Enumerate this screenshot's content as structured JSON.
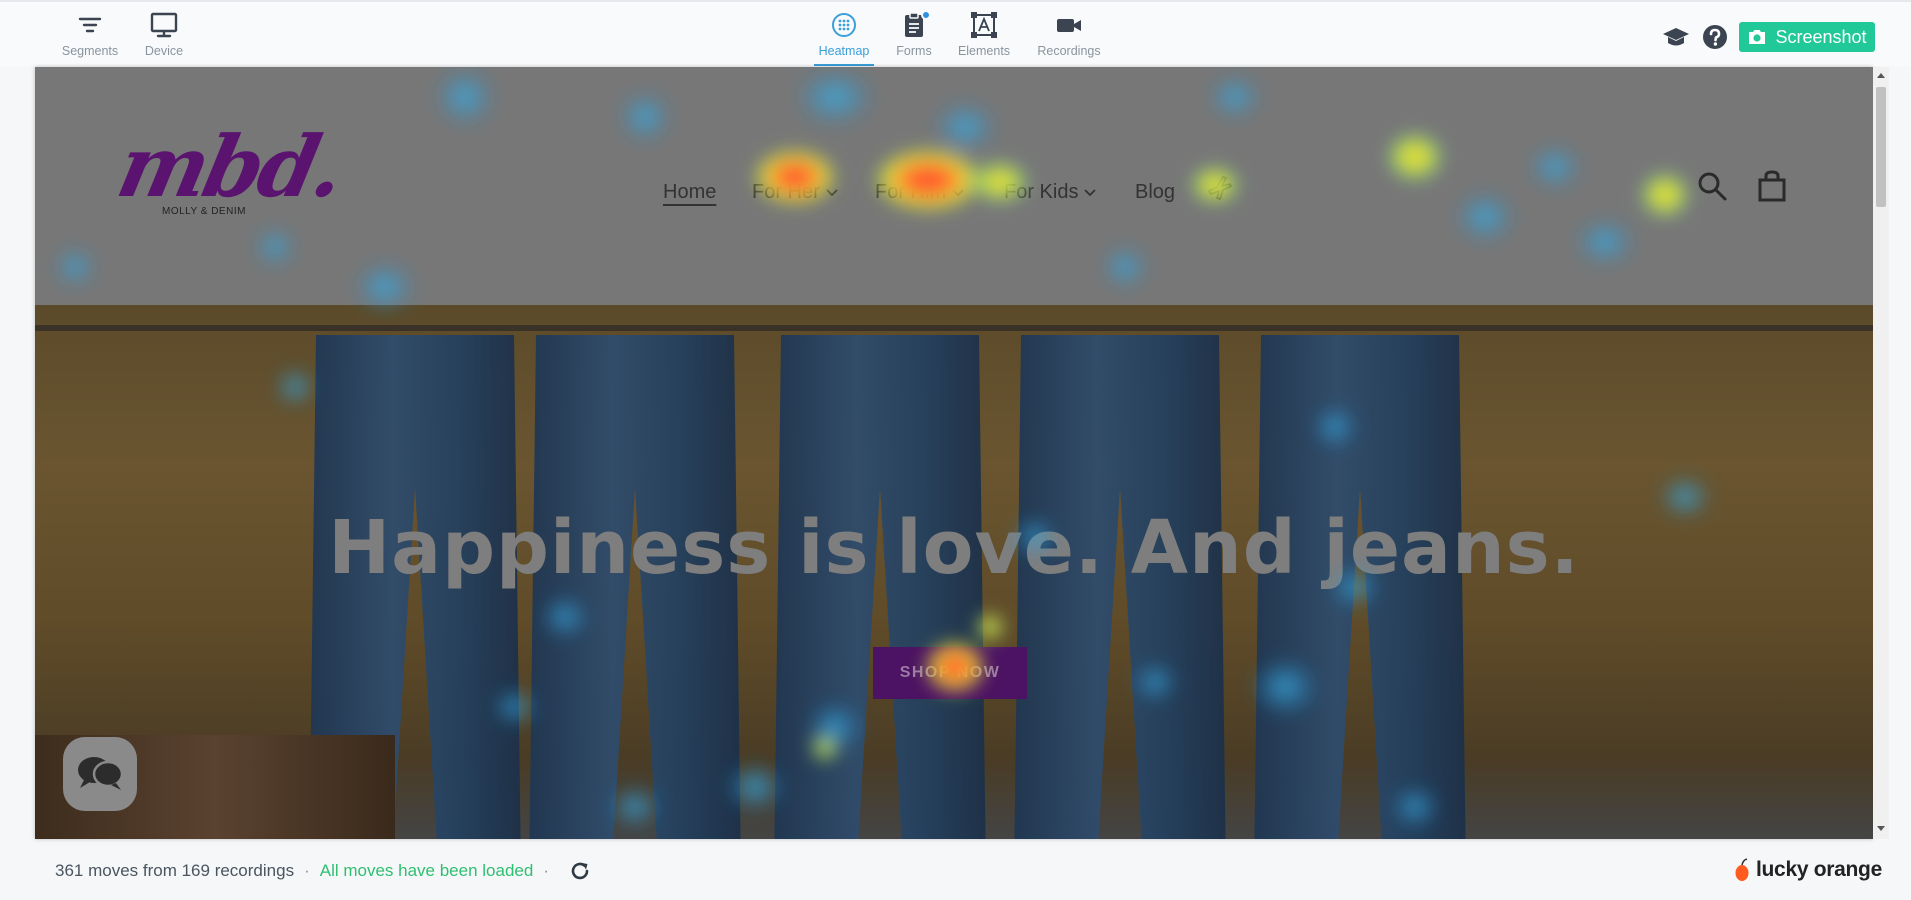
{
  "toolbar": {
    "left_tools": [
      {
        "label": "Segments",
        "icon": "filter-icon"
      },
      {
        "label": "Device",
        "icon": "monitor-icon"
      }
    ],
    "center_tools": [
      {
        "label": "Heatmap",
        "icon": "heatmap-icon",
        "active": true
      },
      {
        "label": "Forms",
        "icon": "clipboard-icon",
        "badge": true
      },
      {
        "label": "Elements",
        "icon": "element-frame-icon"
      },
      {
        "label": "Recordings",
        "icon": "video-camera-icon"
      }
    ],
    "right": {
      "screenshot_label": "Screenshot",
      "accent": "#20c997"
    }
  },
  "site": {
    "logo_text": "mbd.",
    "logo_subtext": "MOLLY & DENIM",
    "logo_color": "#5b1370",
    "nav": [
      {
        "label": "Home",
        "active": true,
        "dropdown": false
      },
      {
        "label": "For Her",
        "dropdown": true
      },
      {
        "label": "For Him",
        "dropdown": true
      },
      {
        "label": "For Kids",
        "dropdown": true
      },
      {
        "label": "Blog",
        "dropdown": false
      }
    ],
    "hero_headline": "Happiness is love. And jeans.",
    "cta_label": "SHOP NOW",
    "cta_color": "#4c1263"
  },
  "status": {
    "moves_text": "361 moves from 169 recordings",
    "loaded_text": "All moves have been loaded",
    "separator": "·"
  },
  "brand": {
    "name": "lucky orange"
  }
}
